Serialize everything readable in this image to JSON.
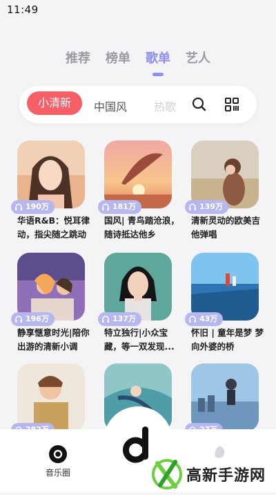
{
  "status": {
    "time": "11:49"
  },
  "top_tabs": [
    {
      "label": "推荐",
      "active": false
    },
    {
      "label": "榜单",
      "active": false
    },
    {
      "label": "歌单",
      "active": true
    },
    {
      "label": "艺人",
      "active": false
    }
  ],
  "filters": [
    {
      "label": "小清新",
      "active": true
    },
    {
      "label": "中国风",
      "active": false
    },
    {
      "label": "热歌",
      "active": false
    }
  ],
  "playlists": [
    {
      "plays": "190万",
      "title": "华语R&B：悦耳律动，指尖随之跳动"
    },
    {
      "plays": "181万",
      "title": "国风| 青鸟踏沧浪，随诗抵达他乡"
    },
    {
      "plays": "139万",
      "title": "清新灵动的欧美吉他弹唱"
    },
    {
      "plays": "196万",
      "title": "静享惬意时光|陪你出游的清新小调"
    },
    {
      "plays": "137万",
      "title": "特立独行|小众宝藏，等一双发现..."
    },
    {
      "plays": "43万",
      "title": "怀旧 | 童年是梦 梦向外婆的桥"
    },
    {
      "plays": "282万",
      "title": ""
    },
    {
      "plays": "",
      "title": ""
    },
    {
      "plays": "27万",
      "title": ""
    }
  ],
  "bottom_nav": {
    "left_label": "音乐圈",
    "watermark_text": "高新手游网"
  },
  "colors": {
    "accent": "#8c8ff4",
    "chip_active": "#f75f67",
    "badge": "#b7b7ef"
  }
}
